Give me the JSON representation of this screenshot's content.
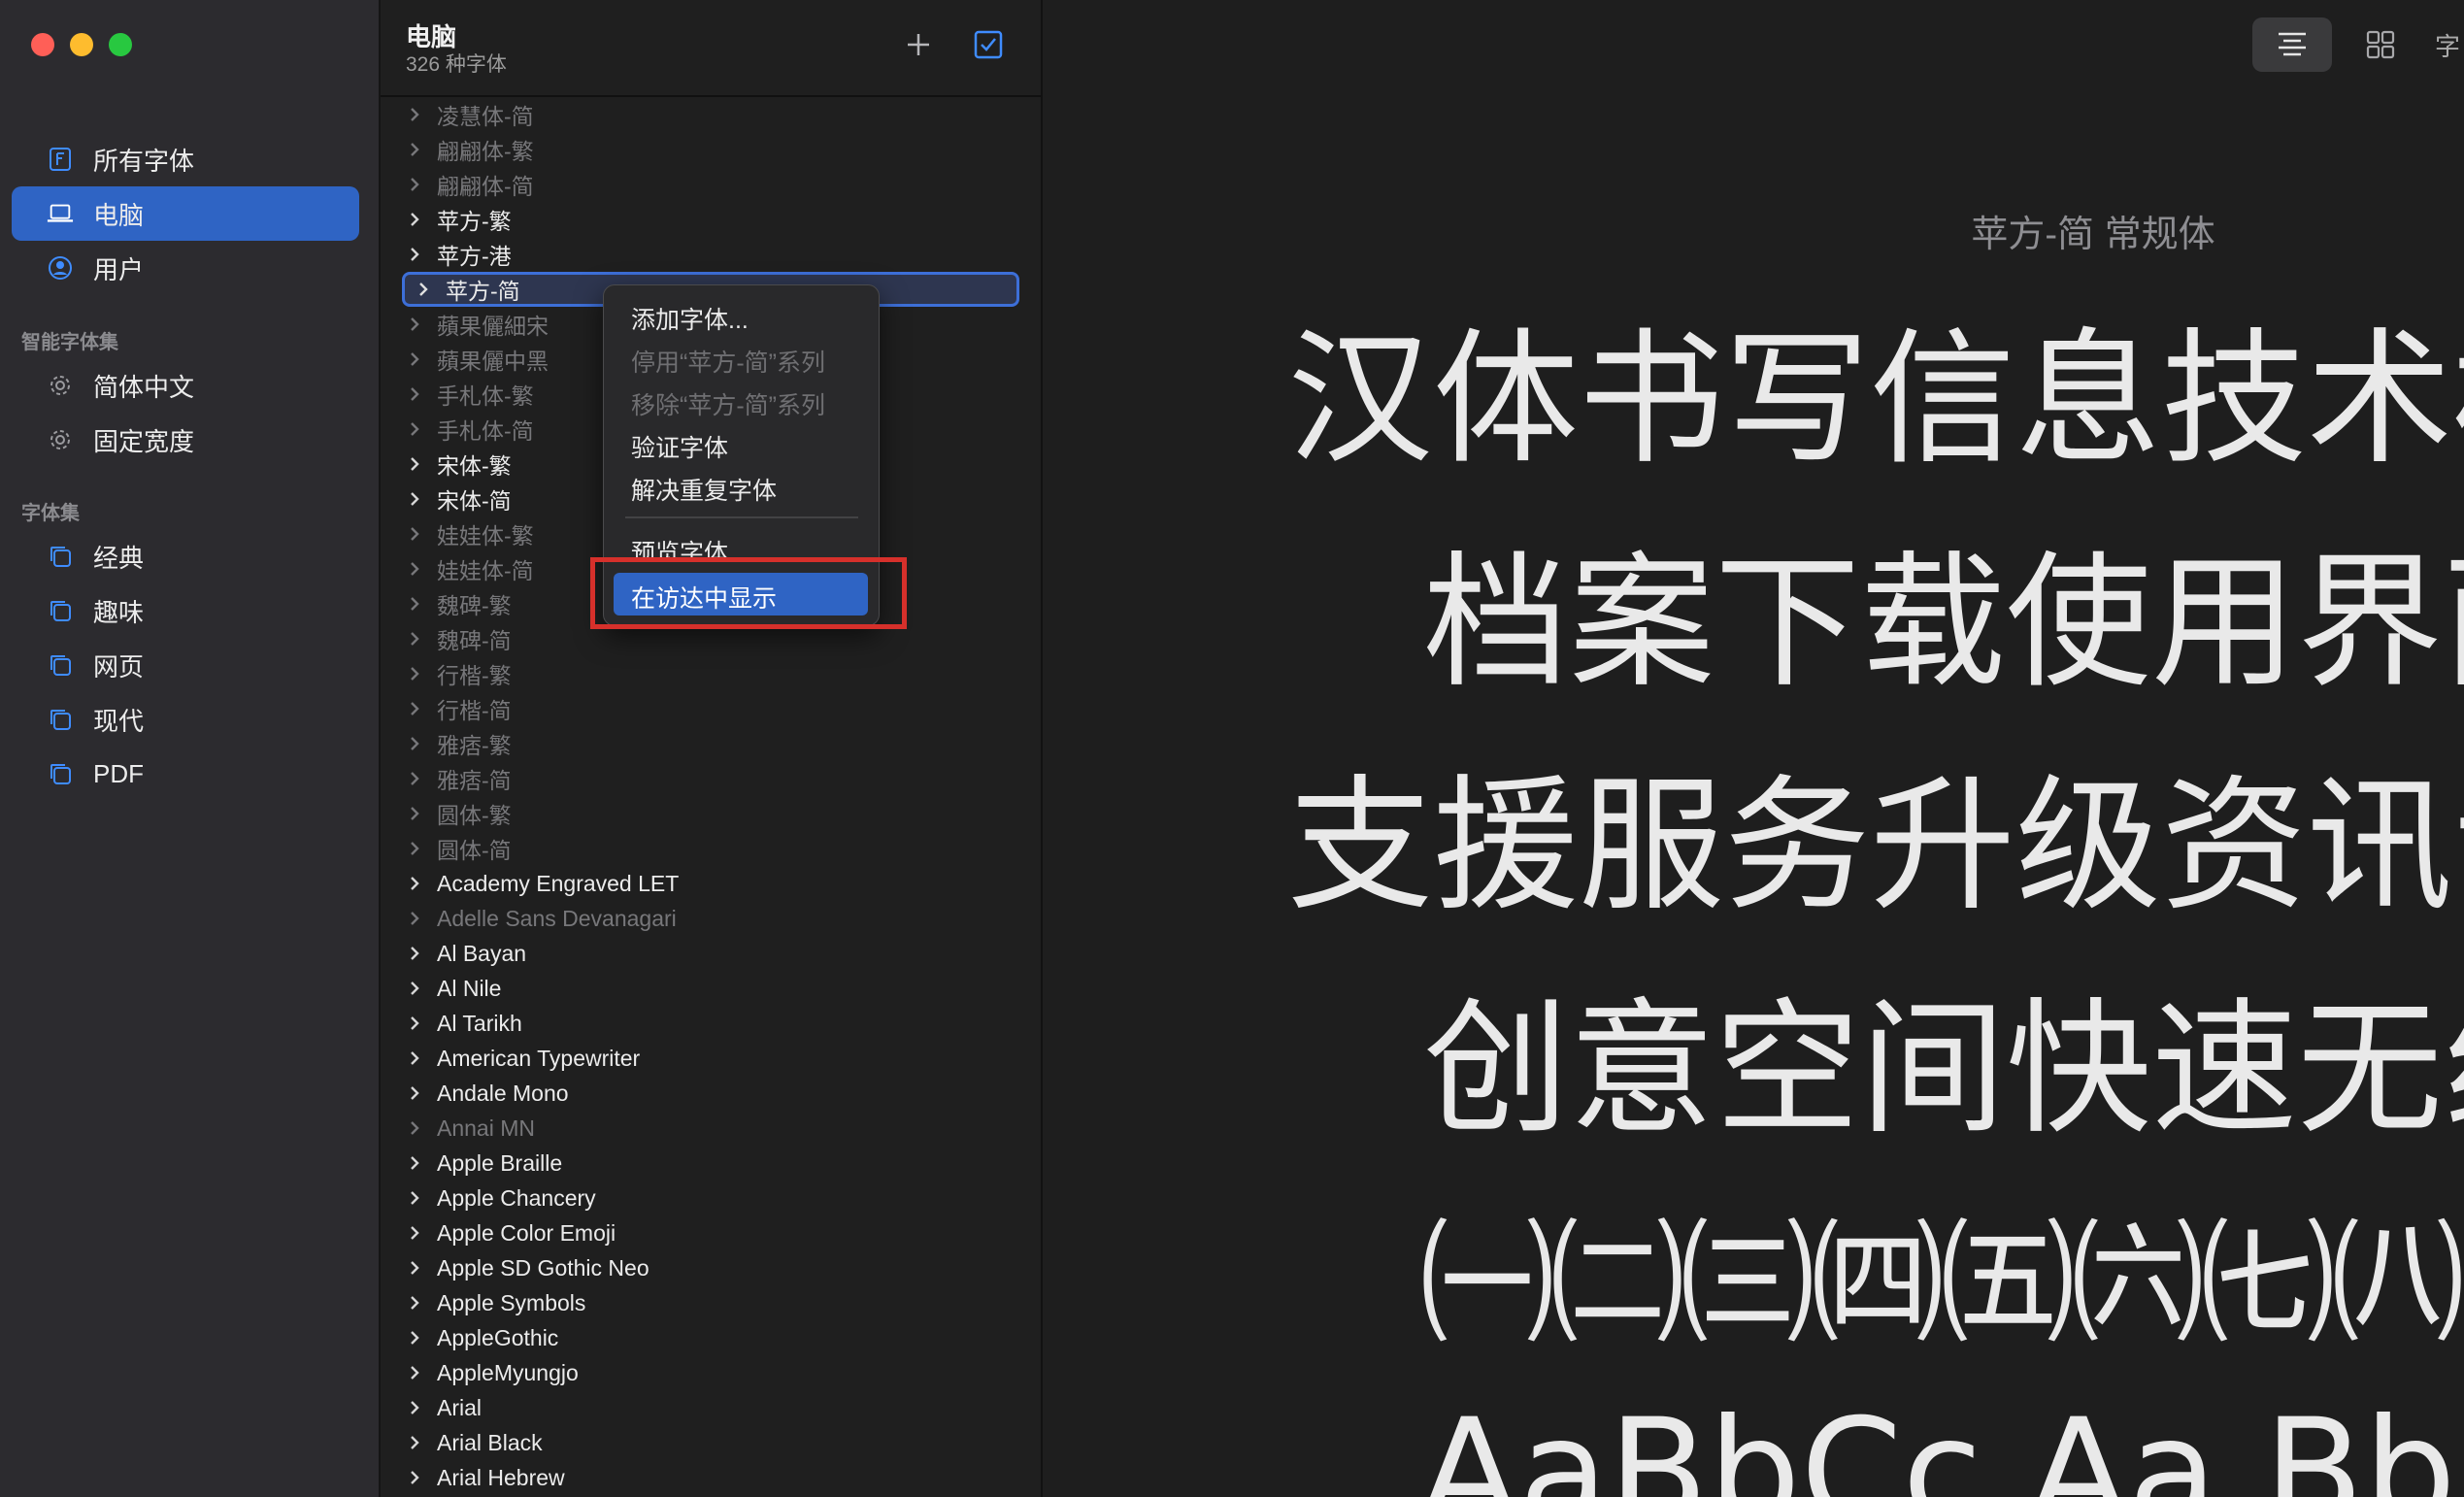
{
  "window": {
    "title": "电脑",
    "subtitle": "326 种字体"
  },
  "sidebar": {
    "library_items": [
      {
        "label": "所有字体",
        "icon": "font-file-icon"
      },
      {
        "label": "电脑",
        "icon": "laptop-icon",
        "selected": true
      },
      {
        "label": "用户",
        "icon": "user-icon"
      }
    ],
    "smart_collections_header": "智能字体集",
    "smart_collections": [
      {
        "label": "简体中文",
        "icon": "gear-icon"
      },
      {
        "label": "固定宽度",
        "icon": "gear-icon"
      }
    ],
    "collections_header": "字体集",
    "collections": [
      {
        "label": "经典",
        "icon": "collection-icon"
      },
      {
        "label": "趣味",
        "icon": "collection-icon"
      },
      {
        "label": "网页",
        "icon": "collection-icon"
      },
      {
        "label": "现代",
        "icon": "collection-icon"
      },
      {
        "label": "PDF",
        "icon": "collection-icon"
      }
    ]
  },
  "toolbar": {
    "add_icon": "plus-icon",
    "check_icon": "checkbox-icon",
    "view_list_icon": "list-view-icon",
    "view_grid_icon": "grid-view-icon",
    "truncated_label": "字"
  },
  "font_list": [
    {
      "name": "凌慧体-简",
      "dim": true
    },
    {
      "name": "翩翩体-繁",
      "dim": true
    },
    {
      "name": "翩翩体-简",
      "dim": true
    },
    {
      "name": "苹方-繁",
      "dim": false
    },
    {
      "name": "苹方-港",
      "dim": false
    },
    {
      "name": "苹方-简",
      "dim": false,
      "selected": true
    },
    {
      "name": "蘋果儷細宋",
      "dim": true
    },
    {
      "name": "蘋果儷中黑",
      "dim": true
    },
    {
      "name": "手札体-繁",
      "dim": true
    },
    {
      "name": "手札体-简",
      "dim": true
    },
    {
      "name": "宋体-繁",
      "dim": false
    },
    {
      "name": "宋体-简",
      "dim": false
    },
    {
      "name": "娃娃体-繁",
      "dim": true
    },
    {
      "name": "娃娃体-简",
      "dim": true
    },
    {
      "name": "魏碑-繁",
      "dim": true
    },
    {
      "name": "魏碑-简",
      "dim": true
    },
    {
      "name": "行楷-繁",
      "dim": true
    },
    {
      "name": "行楷-简",
      "dim": true
    },
    {
      "name": "雅痞-繁",
      "dim": true
    },
    {
      "name": "雅痞-简",
      "dim": true
    },
    {
      "name": "圆体-繁",
      "dim": true
    },
    {
      "name": "圆体-简",
      "dim": true
    },
    {
      "name": "Academy Engraved LET",
      "dim": false
    },
    {
      "name": "Adelle Sans Devanagari",
      "dim": true
    },
    {
      "name": "Al Bayan",
      "dim": false
    },
    {
      "name": "Al Nile",
      "dim": false
    },
    {
      "name": "Al Tarikh",
      "dim": false
    },
    {
      "name": "American Typewriter",
      "dim": false
    },
    {
      "name": "Andale Mono",
      "dim": false
    },
    {
      "name": "Annai MN",
      "dim": true
    },
    {
      "name": "Apple Braille",
      "dim": false
    },
    {
      "name": "Apple Chancery",
      "dim": false
    },
    {
      "name": "Apple Color Emoji",
      "dim": false
    },
    {
      "name": "Apple SD Gothic Neo",
      "dim": false
    },
    {
      "name": "Apple Symbols",
      "dim": false
    },
    {
      "name": "AppleGothic",
      "dim": false
    },
    {
      "name": "AppleMyungjo",
      "dim": false
    },
    {
      "name": "Arial",
      "dim": false
    },
    {
      "name": "Arial Black",
      "dim": false
    },
    {
      "name": "Arial Hebrew",
      "dim": false
    }
  ],
  "context_menu": {
    "items": [
      {
        "label": "添加字体...",
        "disabled": false
      },
      {
        "label": "停用“苹方-简”系列",
        "disabled": true
      },
      {
        "label": "移除“苹方-简”系列",
        "disabled": true
      },
      {
        "label": "验证字体",
        "disabled": false
      },
      {
        "label": "解决重复字体",
        "disabled": false
      }
    ],
    "preview_label": "预览字体",
    "highlighted_label": "在访达中显示"
  },
  "preview": {
    "font_title": "苹方-简 常规体",
    "lines": [
      "汉体书写信息技术标",
      "档案下载使用界面",
      "支援服务升级资讯专",
      "创意空间快速无线",
      "㈠㈡㈢㈣㈤㈥㈦㈧",
      "AaBbCc Aa Bb"
    ]
  },
  "colors": {
    "accent": "#2f64c4",
    "callout": "#d6302b",
    "window_close": "#ff5f57",
    "window_minimize": "#febc2e",
    "window_zoom": "#28c840"
  }
}
